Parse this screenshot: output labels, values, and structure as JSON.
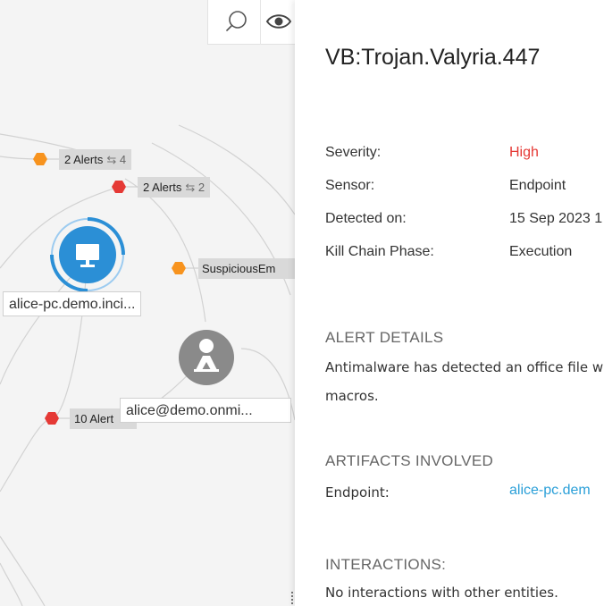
{
  "toolbar": {
    "search_icon": "search-icon",
    "view_icon": "eye-icon"
  },
  "graph": {
    "alerts": [
      {
        "label": "2 Alerts",
        "count": "4",
        "severity_color": "#f7931e"
      },
      {
        "label": "2 Alerts",
        "count": "2",
        "severity_color": "#e53935"
      },
      {
        "label": "SuspiciousEm",
        "count": "",
        "severity_color": "#f7931e"
      },
      {
        "label": "10 Alert",
        "count": "",
        "severity_color": "#e53935"
      }
    ],
    "nodes": {
      "host": {
        "label": "alice-pc.demo.inci...",
        "icon": "monitor-icon",
        "color": "#2b8fd6"
      },
      "user": {
        "label": "alice@demo.onmi...",
        "icon": "user-icon",
        "color": "#8a8a8a"
      }
    },
    "link_symbol": "⇆"
  },
  "panel": {
    "title": "VB:Trojan.Valyria.447",
    "properties": [
      {
        "label": "Severity:",
        "value": "High",
        "color": "#e53935"
      },
      {
        "label": "Sensor:",
        "value": "Endpoint",
        "color": "#333333"
      },
      {
        "label": "Detected on:",
        "value": "15 Sep 2023 1",
        "color": "#333333"
      },
      {
        "label": "Kill Chain Phase:",
        "value": "Execution",
        "color": "#333333"
      }
    ],
    "alert_details_heading": "ALERT DETAILS",
    "alert_details_line1": "Antimalware has detected an office file w",
    "alert_details_line2": "macros.",
    "artifacts_heading": "ARTIFACTS INVOLVED",
    "artifact_label": "Endpoint:",
    "artifact_value": "alice-pc.dem",
    "interactions_heading": "INTERACTIONS:",
    "interactions_text": "No interactions with other entities."
  }
}
